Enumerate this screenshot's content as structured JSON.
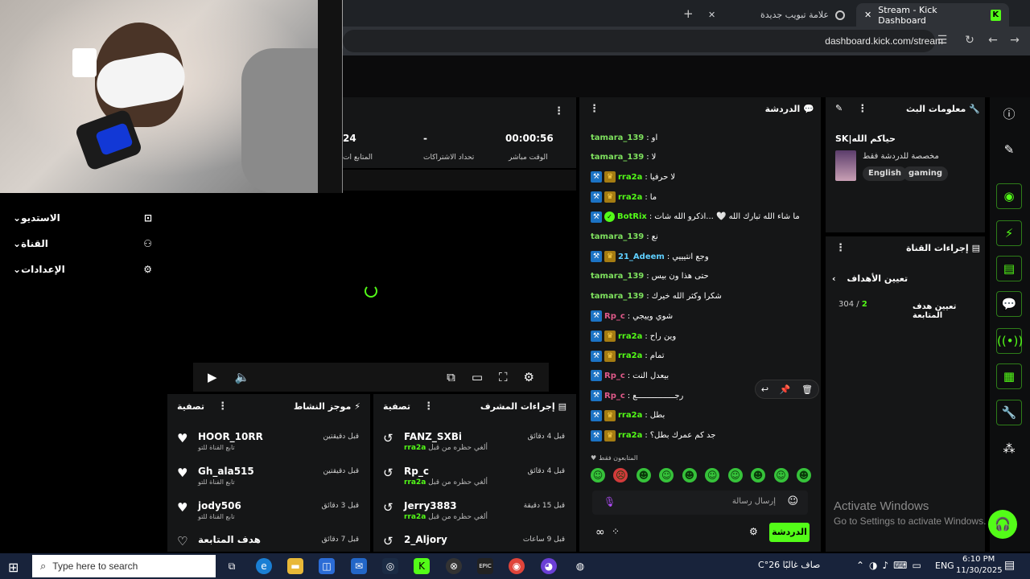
{
  "browser": {
    "tabs": [
      {
        "label": "Stream - Kick Dashboard",
        "active": true
      },
      {
        "label": "علامة تبويب جديدة",
        "active": false
      }
    ],
    "url": "dashboard.kick.com/stream"
  },
  "stats": {
    "elapsed": "00:00:56",
    "dash": "-",
    "partial": "24",
    "label_elapsed": "الوقت مباشر",
    "label_sub": "تحداد الاشتراكات",
    "label_follow": "المتابع ات"
  },
  "leftnav": [
    {
      "label": "الاستديو"
    },
    {
      "label": "القناة"
    },
    {
      "label": "الإعدادات"
    }
  ],
  "activity": {
    "title": "موجز النشاط",
    "clear": "تصفية",
    "items": [
      {
        "name": "HOOR_10RR",
        "sub": "تابع القناة للتو",
        "time": "قبل دقيقتين"
      },
      {
        "name": "Gh_ala515",
        "sub": "تابع القناة للتو",
        "time": "قبل دقيقتين"
      },
      {
        "name": "jody506",
        "sub": "تابع القناة للتو",
        "time": "قبل 3 دقائق"
      },
      {
        "name": "هدف المتابعة",
        "sub": "",
        "time": "قبل 7 دقائق"
      }
    ]
  },
  "mod": {
    "title": "إجراءات المشرف",
    "clear": "تصفية",
    "items": [
      {
        "name": "FANZ_SXBi",
        "sub": "ألغي حظره من قبل",
        "by": "rra2a",
        "time": "قبل 4 دقائق"
      },
      {
        "name": "Rp_c",
        "sub": "ألغي حظره من قبل",
        "by": "rra2a",
        "time": "قبل 4 دقائق"
      },
      {
        "name": "Jerry3883",
        "sub": "ألغي حظره من قبل",
        "by": "rra2a",
        "time": "قبل 15 دقيقة"
      },
      {
        "name": "2_Aljory",
        "sub": "",
        "by": "",
        "time": "قبل 9 ساعات"
      }
    ]
  },
  "chat": {
    "title": "الدردشة",
    "followers_only": "المتابعون فقط",
    "placeholder": "إرسال رسالة",
    "send": "الدردشة",
    "messages": [
      {
        "user": "tamara_139",
        "color": "#7ee15e",
        "badges": [],
        "text": "او"
      },
      {
        "user": "tamara_139",
        "color": "#7ee15e",
        "badges": [],
        "text": "لا"
      },
      {
        "user": "rra2a",
        "color": "#53fc18",
        "badges": [
          "mod",
          "crown"
        ],
        "text": "لا حرفيا"
      },
      {
        "user": "rra2a",
        "color": "#53fc18",
        "badges": [
          "mod",
          "crown"
        ],
        "text": "ما"
      },
      {
        "user": "BotRix",
        "color": "#53fc18",
        "badges": [
          "mod",
          "ver"
        ],
        "text": "ما شاء الله تبارك الله 🤍 ...اذكرو الله شات"
      },
      {
        "user": "tamara_139",
        "color": "#7ee15e",
        "badges": [],
        "text": "نع"
      },
      {
        "user": "21_Adeem",
        "color": "#5fd0ff",
        "badges": [
          "mod",
          "crown"
        ],
        "text": "وجع انتيييي"
      },
      {
        "user": "tamara_139",
        "color": "#7ee15e",
        "badges": [],
        "text": "حتى هذا ون بيس"
      },
      {
        "user": "tamara_139",
        "color": "#7ee15e",
        "badges": [],
        "text": "شكرا وكثر الله خيرك"
      },
      {
        "user": "Rp_c",
        "color": "#e05a8a",
        "badges": [
          "mod"
        ],
        "text": "شوي وييجي"
      },
      {
        "user": "rra2a",
        "color": "#53fc18",
        "badges": [
          "mod",
          "crown"
        ],
        "text": "وين راح"
      },
      {
        "user": "rra2a",
        "color": "#53fc18",
        "badges": [
          "mod",
          "crown"
        ],
        "text": "تمام"
      },
      {
        "user": "Rp_c",
        "color": "#e05a8a",
        "badges": [
          "mod"
        ],
        "text": "بيعدل النت"
      },
      {
        "user": "Rp_c",
        "color": "#e05a8a",
        "badges": [
          "mod"
        ],
        "text": "رجــــــــــــــــع"
      },
      {
        "user": "rra2a",
        "color": "#53fc18",
        "badges": [
          "mod",
          "crown"
        ],
        "text": "بطل"
      },
      {
        "user": "rra2a",
        "color": "#53fc18",
        "badges": [
          "mod",
          "crown"
        ],
        "text": "جد كم عمرك بطل؟"
      }
    ]
  },
  "streaminfo": {
    "title": "معلومات البث",
    "stream_title": "SK|حياكم الله",
    "category": "مخصصة للدردشة فقط",
    "tags": [
      "English",
      "gaming"
    ]
  },
  "channel_actions": {
    "title": "إجراءات القناة",
    "back_label": "تعيين الأهداف",
    "goal_label": "تعيين هدف المتابعة",
    "goal_current": "2",
    "goal_total": "304"
  },
  "watermark": {
    "line1": "Activate Windows",
    "line2": "Go to Settings to activate Windows."
  },
  "taskbar": {
    "search": "Type here to search",
    "weather": "صاف غالبًا 26°C",
    "lang": "ENG",
    "time": "6:10 PM",
    "date": "11/30/2025"
  },
  "colors": {
    "kick_green": "#53fc18",
    "panel": "#151617"
  }
}
